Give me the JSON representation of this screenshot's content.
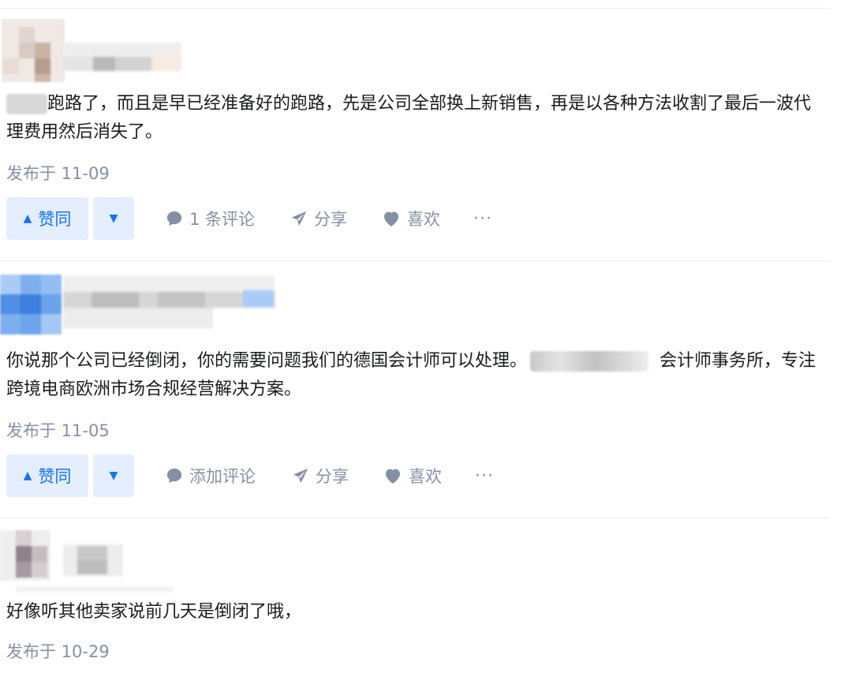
{
  "answers": [
    {
      "content": "跑路了，而且是早已经准备好的跑路，先是公司全部换上新销售，再是以各种方法收割了最后一波代理费用然后消失了。",
      "time": "发布于 11-09",
      "vote_label": "赞同",
      "comment_label": "1 条评论",
      "share_label": "分享",
      "like_label": "喜欢",
      "more_label": "···"
    },
    {
      "content_before": "你说那个公司已经倒闭，你的需要问题我们的德国会计师可以处理。",
      "content_after": "会计师事务所，专注跨境电商欧洲市场合规经营解决方案。",
      "time": "发布于 11-05",
      "vote_label": "赞同",
      "comment_label": "添加评论",
      "share_label": "分享",
      "like_label": "喜欢",
      "more_label": "···"
    },
    {
      "content": "好像听其他卖家说前几天是倒闭了哦，",
      "time": "发布于 10-29"
    }
  ],
  "colors": {
    "accent": "#1772f6",
    "vote_bg": "#e5eefd",
    "meta": "#8590a6",
    "text": "#191b1f"
  }
}
